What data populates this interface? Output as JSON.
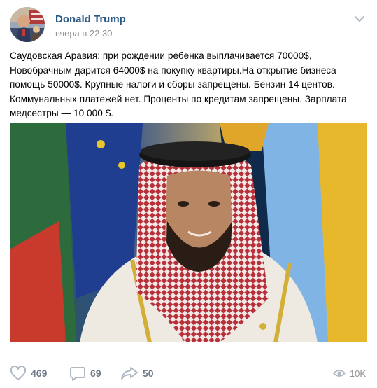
{
  "post": {
    "author_name": "Donald Trump",
    "timestamp": "вчера в 22:30",
    "text": "Саудовская Аравия: при рождении ребенка выплачивается 70000$, Новобрачным дарится 64000$ на покупку квартиры.На открытие бизнеса помощь 50000$. Крупные налоги и сборы запрещены. Бензин 14 центов. Коммунальных платежей нет. Проценты по кредитам запрещены. Зарплата медсестры — 10 000 $.",
    "menu_icon": "chevron-down-icon",
    "avatar_icon": "avatar-image"
  },
  "actions": {
    "likes": {
      "icon": "heart-icon",
      "count": "469"
    },
    "comments": {
      "icon": "comment-icon",
      "count": "69"
    },
    "shares": {
      "icon": "share-icon",
      "count": "50"
    },
    "views": {
      "icon": "eye-icon",
      "count": "10K"
    }
  },
  "colors": {
    "author_link": "#2a5885",
    "muted_text": "#939393",
    "action_count": "#6d7885",
    "icon_gray": "#aeb7c2"
  }
}
